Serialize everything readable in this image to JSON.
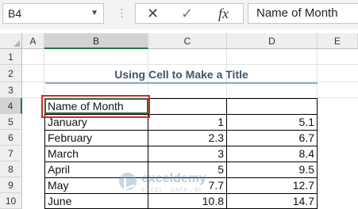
{
  "name_box": {
    "value": "B4",
    "dropdown_icon": "chevron-down-icon"
  },
  "formula_bar": {
    "separator_icon": "vertical-dots-icon",
    "cancel_icon": "close-icon",
    "enter_icon": "checkmark-icon",
    "function_label": "fx",
    "content": "Name of Month"
  },
  "columns": [
    "A",
    "B",
    "C",
    "D",
    "E"
  ],
  "active_column": "B",
  "rows": [
    "1",
    "2",
    "3",
    "4",
    "5",
    "6",
    "7",
    "8",
    "9",
    "10"
  ],
  "active_row": "4",
  "sheet": {
    "title": "Using Cell to Make a Title",
    "table": {
      "header": [
        "Name of Month",
        "",
        ""
      ],
      "rows": [
        [
          "January",
          "1",
          "5.1"
        ],
        [
          "February",
          "2.3",
          "6.7"
        ],
        [
          "March",
          "3",
          "8.4"
        ],
        [
          "April",
          "5",
          "9.5"
        ],
        [
          "May",
          "7.7",
          "12.7"
        ],
        [
          "June",
          "10.8",
          "14.7"
        ]
      ]
    }
  },
  "watermark": {
    "name": "exceldemy",
    "tagline": "EXCEL · DATA · BI"
  },
  "colors": {
    "accent_green": "#217346",
    "highlight_red": "#d9252a",
    "title_color": "#44546a"
  }
}
